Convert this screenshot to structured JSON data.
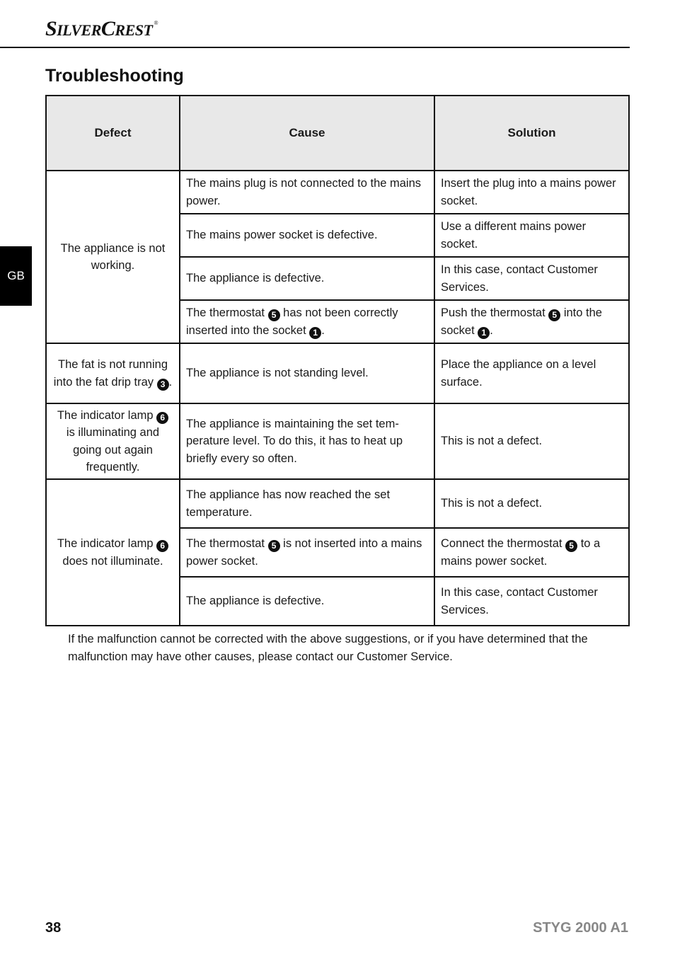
{
  "header": {
    "brand_big1": "S",
    "brand_small1": "ILVER",
    "brand_big2": "C",
    "brand_small2": "REST",
    "registered": "®"
  },
  "title": "Troubleshooting",
  "side_tab": "GB",
  "table": {
    "headers": {
      "defect": "Defect",
      "cause": "Cause",
      "solution": "Solution"
    },
    "groups": [
      {
        "defect": "The appliance is not working.",
        "rows": [
          {
            "cause": "The mains plug is not connected to the mains power.",
            "solution": "Insert the plug into a mains power socket."
          },
          {
            "cause": "The mains power socket is defective.",
            "solution": "Use a different mains power socket."
          },
          {
            "cause": "The appliance is defective.",
            "solution": "In this case, contact Customer Services."
          },
          {
            "cause_pre": "The thermostat ",
            "cause_n1": "5",
            "cause_mid": " has not been correctly inserted into the socket ",
            "cause_n2": "1",
            "cause_post": ".",
            "sol_pre": "Push the thermostat ",
            "sol_n1": "5",
            "sol_mid": " into the socket ",
            "sol_n2": "1",
            "sol_post": "."
          }
        ]
      },
      {
        "defect_pre": "The fat is not running into the fat drip tray ",
        "defect_n": "3",
        "defect_post": ".",
        "rows": [
          {
            "cause": "The appliance is not standing level.",
            "solution": "Place the appliance on a level surface."
          }
        ]
      },
      {
        "defect_pre": "The indicator lamp ",
        "defect_n": "6",
        "defect_post": " is illuminat­ing and going out again frequently.",
        "rows": [
          {
            "cause": "The appliance is maintaining the set tem­perature level. To do this, it has to heat up briefly every so often.",
            "solution": "This is not a defect."
          }
        ]
      },
      {
        "defect_pre": "The indicator lamp ",
        "defect_n": "6",
        "defect_post": " does not illuminate.",
        "rows": [
          {
            "cause": "The appliance has now reached the set temperature.",
            "solution": "This is not a defect."
          },
          {
            "cause_pre": "The thermostat ",
            "cause_n1": "5",
            "cause_post": " is not inserted into a mains power socket.",
            "sol_pre": "Connect the thermostat ",
            "sol_n1": "5",
            "sol_post": " to a mains power socket."
          },
          {
            "cause": "The appliance is defective.",
            "solution": "In this case, contact Customer Services."
          }
        ]
      }
    ]
  },
  "note": "If the malfunction cannot be corrected with the above suggestions, or if you have determined that the malfunction may have other causes, please contact our Customer Service.",
  "footer": {
    "page_number": "38",
    "model": "STYG 2000 A1"
  }
}
